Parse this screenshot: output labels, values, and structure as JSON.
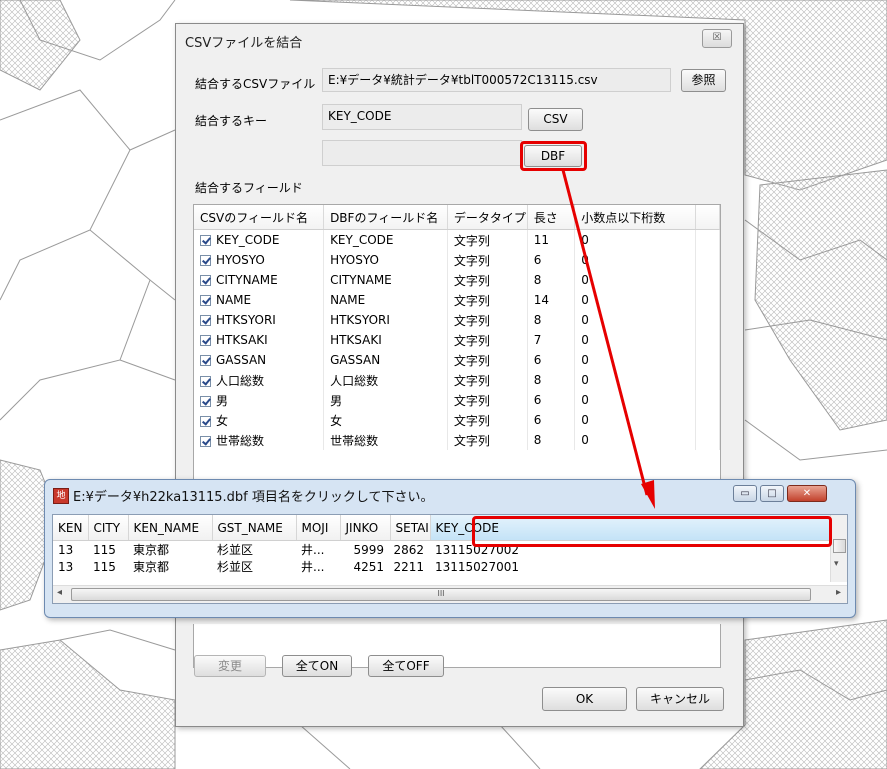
{
  "dialog": {
    "title": "CSVファイルを結合",
    "close_glyph": "☒",
    "csv_file_label": "結合するCSVファイル",
    "csv_file_value": "E:¥データ¥統計データ¥tblT000572C13115.csv",
    "browse_button": "参照",
    "key_label": "結合するキー",
    "csv_key_value": "KEY_CODE",
    "csv_button": "CSV",
    "dbf_key_value": "",
    "dbf_button": "DBF",
    "fields_label": "結合するフィールド",
    "columns": [
      "CSVのフィールド名",
      "DBFのフィールド名",
      "データタイプ",
      "長さ",
      "小数点以下桁数"
    ],
    "rows": [
      {
        "csv": "KEY_CODE",
        "dbf": "KEY_CODE",
        "type": "文字列",
        "len": "11",
        "dec": "0"
      },
      {
        "csv": "HYOSYO",
        "dbf": "HYOSYO",
        "type": "文字列",
        "len": "6",
        "dec": "0"
      },
      {
        "csv": "CITYNAME",
        "dbf": "CITYNAME",
        "type": "文字列",
        "len": "8",
        "dec": "0"
      },
      {
        "csv": "NAME",
        "dbf": "NAME",
        "type": "文字列",
        "len": "14",
        "dec": "0"
      },
      {
        "csv": "HTKSYORI",
        "dbf": "HTKSYORI",
        "type": "文字列",
        "len": "8",
        "dec": "0"
      },
      {
        "csv": "HTKSAKI",
        "dbf": "HTKSAKI",
        "type": "文字列",
        "len": "7",
        "dec": "0"
      },
      {
        "csv": "GASSAN",
        "dbf": "GASSAN",
        "type": "文字列",
        "len": "6",
        "dec": "0"
      },
      {
        "csv": "人口総数",
        "dbf": "人口総数",
        "type": "文字列",
        "len": "8",
        "dec": "0"
      },
      {
        "csv": "男",
        "dbf": "男",
        "type": "文字列",
        "len": "6",
        "dec": "0"
      },
      {
        "csv": "女",
        "dbf": "女",
        "type": "文字列",
        "len": "6",
        "dec": "0"
      },
      {
        "csv": "世帯総数",
        "dbf": "世帯総数",
        "type": "文字列",
        "len": "8",
        "dec": "0"
      }
    ],
    "change_button": "変更",
    "all_on_button": "全てON",
    "all_off_button": "全てOFF",
    "ok_button": "OK",
    "cancel_button": "キャンセル"
  },
  "dbf_window": {
    "icon_text": "地",
    "title": "E:¥データ¥h22ka13115.dbf  項目名をクリックして下さい。",
    "minimize_glyph": "▭",
    "maximize_glyph": "□",
    "close_glyph": "✕",
    "columns": [
      "KEN",
      "CITY",
      "KEN_NAME",
      "GST_NAME",
      "MOJI",
      "JINKO",
      "SETAI",
      "KEY_CODE"
    ],
    "rows": [
      [
        "13",
        "115",
        "東京都",
        "杉並区",
        "井...",
        "5999",
        "2862",
        "13115027002"
      ],
      [
        "13",
        "115",
        "東京都",
        "杉並区",
        "井...",
        "4251",
        "2211",
        "13115027001"
      ]
    ],
    "scroll_left": "◂",
    "scroll_right": "▸",
    "scroll_up": "▴",
    "scroll_down": "▾",
    "scroll_thumb": "III"
  },
  "colors": {
    "highlight": "#e60000",
    "window_frame": "#d6e4f3"
  }
}
